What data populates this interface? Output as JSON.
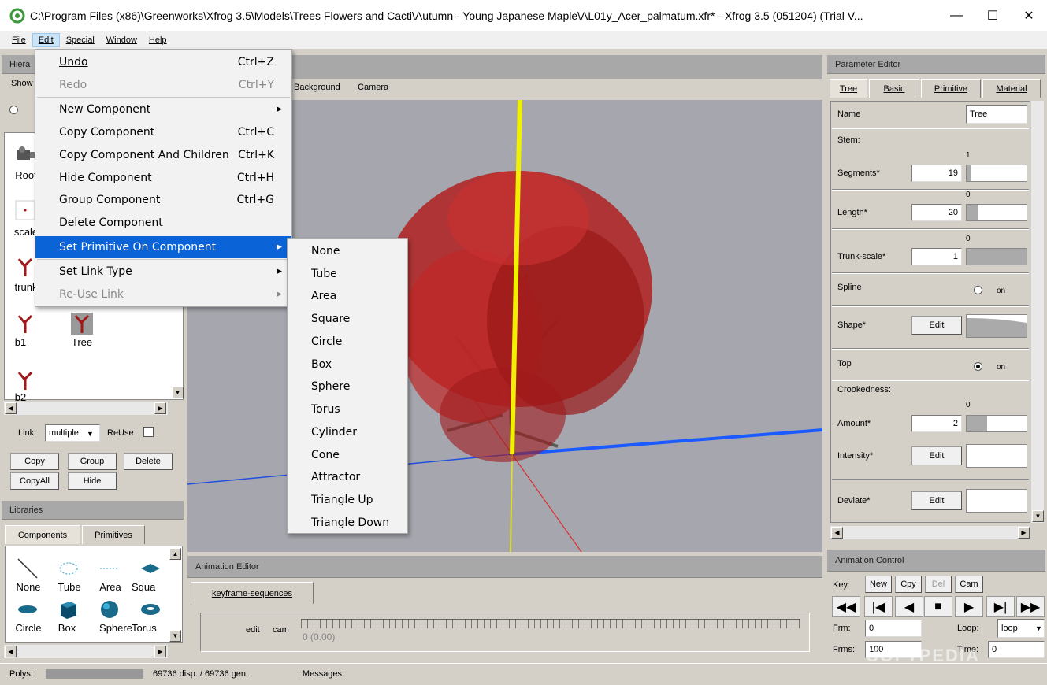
{
  "window": {
    "title": "C:\\Program Files (x86)\\Greenworks\\Xfrog 3.5\\Models\\Trees Flowers and Cacti\\Autumn - Young Japanese Maple\\AL01y_Acer_palmatum.xfr* - Xfrog 3.5 (051204) (Trial V...",
    "minimize": "—",
    "maximize": "☐",
    "close": "✕"
  },
  "menubar": [
    "File",
    "Edit",
    "Special",
    "Window",
    "Help"
  ],
  "edit_menu": [
    {
      "label": "Undo",
      "shortcut": "Ctrl+Z",
      "disabled": false
    },
    {
      "label": "Redo",
      "shortcut": "Ctrl+Y",
      "disabled": true
    },
    {
      "label": "New Component",
      "submenu": true
    },
    {
      "label": "Copy Component",
      "shortcut": "Ctrl+C"
    },
    {
      "label": "Copy Component And Children",
      "shortcut": "Ctrl+K"
    },
    {
      "label": "Hide Component",
      "shortcut": "Ctrl+H"
    },
    {
      "label": "Group Component",
      "shortcut": "Ctrl+G"
    },
    {
      "label": "Delete Component"
    },
    {
      "label": "Set Primitive On Component",
      "submenu": true,
      "highlighted": true
    },
    {
      "label": "Set Link Type",
      "submenu": true
    },
    {
      "label": "Re-Use Link",
      "submenu": true,
      "disabled": true
    }
  ],
  "primitive_submenu": [
    "None",
    "Tube",
    "Area",
    "Square",
    "Circle",
    "Box",
    "Sphere",
    "Torus",
    "Cylinder",
    "Cone",
    "Attractor",
    "Triangle Up",
    "Triangle Down"
  ],
  "hierarchy": {
    "title": "Hiera",
    "show_label": "Show",
    "nodes": [
      "Root",
      "scale",
      "trunk",
      "b1",
      "Tree",
      "b2"
    ],
    "link_label": "Link",
    "link_value": "multiple",
    "reuse_label": "ReUse",
    "buttons": [
      "Copy",
      "Group",
      "Delete",
      "CopyAll",
      "Hide"
    ]
  },
  "libraries": {
    "title": "Libraries",
    "tabs": [
      "Components",
      "Primitives"
    ],
    "items": [
      "None",
      "Tube",
      "Area",
      "Squa",
      "Circle",
      "Box",
      "Sphere",
      "Torus"
    ]
  },
  "viewport": {
    "menu": [
      "Background",
      "Camera"
    ]
  },
  "animation_editor": {
    "title": "Animation Editor",
    "tab": "keyframe-sequences",
    "edit_label": "edit",
    "cam_label": "cam",
    "time_readout": "0 (0.00)"
  },
  "parameter_editor": {
    "title": "Parameter Editor",
    "tabs": [
      "Tree",
      "Basic",
      "Primitive",
      "Material"
    ],
    "name_label": "Name",
    "name_value": "Tree",
    "stem_label": "Stem:",
    "segments_label": "Segments*",
    "segments_value": "19",
    "segments_top": "1",
    "length_label": "Length*",
    "length_value": "20",
    "length_top": "0",
    "trunkscale_label": "Trunk-scale*",
    "trunkscale_value": "1",
    "trunkscale_top": "0",
    "spline_label": "Spline",
    "on_label": "on",
    "shape_label": "Shape*",
    "edit_label": "Edit",
    "top_label": "Top",
    "crookedness_label": "Crookedness:",
    "amount_label": "Amount*",
    "amount_value": "2",
    "amount_top": "0",
    "intensity_label": "Intensity*",
    "deviate_label": "Deviate*"
  },
  "animation_control": {
    "title": "Animation Control",
    "key_label": "Key:",
    "key_buttons": [
      "New",
      "Cpy",
      "Del",
      "Cam"
    ],
    "frm_label": "Frm:",
    "frm_value": "0",
    "frms_label": "Frms:",
    "frms_value": "100",
    "loop_label": "Loop:",
    "loop_value": "loop",
    "time_label": "Time:",
    "time_value": "0"
  },
  "status": {
    "polys_label": "Polys:",
    "polys_text": "69736 disp. / 69736 gen.",
    "messages_label": "| Messages:"
  },
  "watermark": "SOFTPEDIA"
}
